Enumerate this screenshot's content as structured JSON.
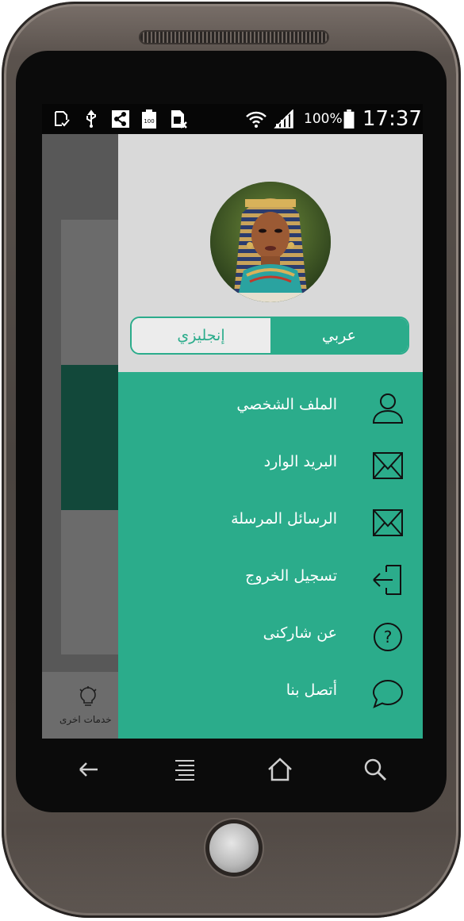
{
  "status_bar": {
    "battery_percent": "100%",
    "time": "17:37",
    "battery_label": "100",
    "icons": [
      "sd-card-check-icon",
      "usb-icon",
      "share-icon",
      "battery-full-icon",
      "sim-card-x-icon",
      "wifi-icon",
      "signal-icon",
      "battery-icon"
    ]
  },
  "background_app": {
    "bottom_tab_label": "خدمات اخرى",
    "bottom_tab_icon": "lightbulb-icon"
  },
  "drawer": {
    "avatar": "profile-avatar",
    "language_toggle": {
      "arabic": "عربي",
      "english": "إنجليزي",
      "selected": "arabic"
    },
    "menu": [
      {
        "label": "الملف الشخصي",
        "icon": "user-icon"
      },
      {
        "label": "البريد الوارد",
        "icon": "envelope-icon"
      },
      {
        "label": "الرسائل المرسلة",
        "icon": "envelope-icon"
      },
      {
        "label": "تسجيل الخروج",
        "icon": "logout-icon"
      },
      {
        "label": "عن شاركنى",
        "icon": "question-circle-icon"
      },
      {
        "label": "أتصل بنا",
        "icon": "chat-bubble-icon"
      }
    ]
  },
  "nav_bar": {
    "buttons": [
      "back-icon",
      "menu-icon",
      "home-icon",
      "search-icon"
    ]
  },
  "colors": {
    "accent": "#2bac8b",
    "drawer_header": "#d9d9d9",
    "status_bar": "#060606",
    "bg_dark_card": "#12483a"
  }
}
